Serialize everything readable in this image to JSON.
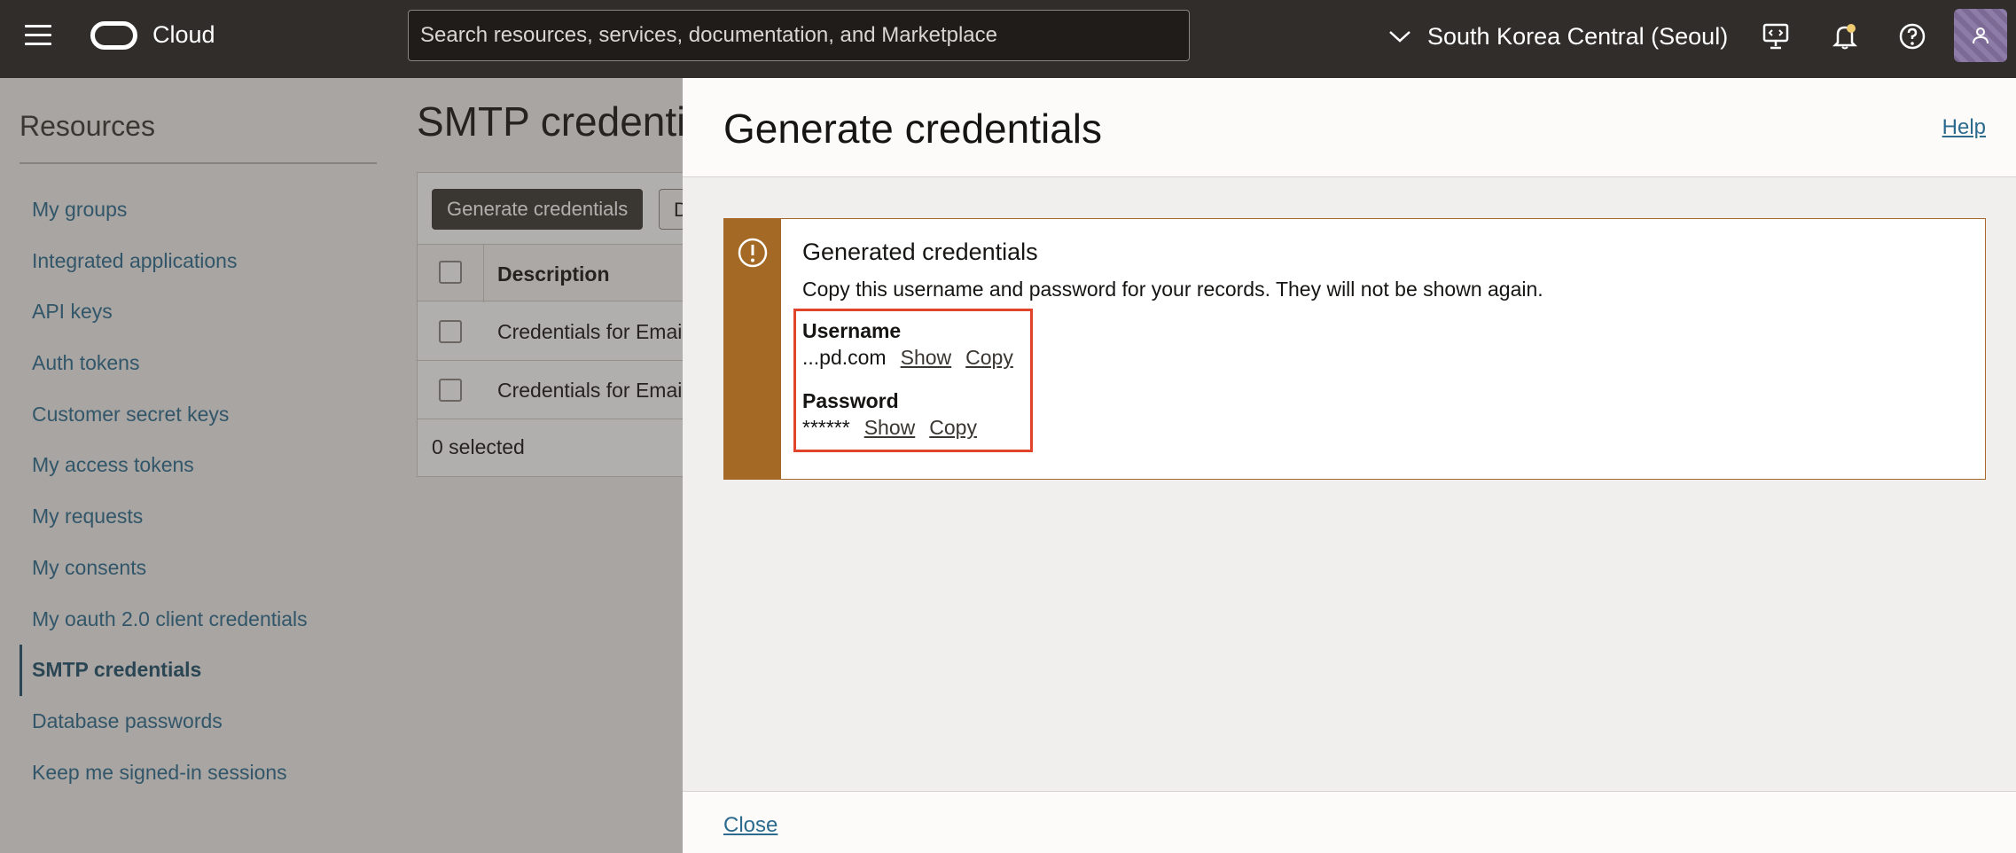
{
  "header": {
    "brand": "Cloud",
    "search_placeholder": "Search resources, services, documentation, and Marketplace",
    "region": "South Korea Central (Seoul)",
    "icons": [
      "menu-icon",
      "oracle-logo",
      "chevron-down-icon",
      "developer-tools-icon",
      "bell-icon",
      "help-icon",
      "user-icon"
    ]
  },
  "sidebar": {
    "title": "Resources",
    "items": [
      {
        "label": "My groups"
      },
      {
        "label": "Integrated applications"
      },
      {
        "label": "API keys"
      },
      {
        "label": "Auth tokens"
      },
      {
        "label": "Customer secret keys"
      },
      {
        "label": "My access tokens"
      },
      {
        "label": "My requests"
      },
      {
        "label": "My consents"
      },
      {
        "label": "My oauth 2.0 client credentials"
      },
      {
        "label": "SMTP credentials",
        "active": true
      },
      {
        "label": "Database passwords"
      },
      {
        "label": "Keep me signed-in sessions"
      }
    ]
  },
  "main": {
    "title": "SMTP credentials",
    "generate_button": "Generate credentials",
    "delete_button": "Delete",
    "table": {
      "columns": [
        "Description"
      ],
      "rows": [
        "Credentials for Email Delivery",
        "Credentials for Email Delivery"
      ]
    },
    "selected_count": "0 selected"
  },
  "drawer": {
    "title": "Generate credentials",
    "help": "Help",
    "alert": {
      "title": "Generated credentials",
      "message": "Copy this username and password for your records. They will not be shown again.",
      "username_label": "Username",
      "username_value": "...pd.com",
      "password_label": "Password",
      "password_value": "******",
      "show_label": "Show",
      "copy_label": "Copy"
    },
    "close": "Close"
  },
  "colors": {
    "topbar": "#312d2a",
    "warning": "#a36925",
    "link": "#2c6b8e",
    "highlight": "#e0452c"
  }
}
